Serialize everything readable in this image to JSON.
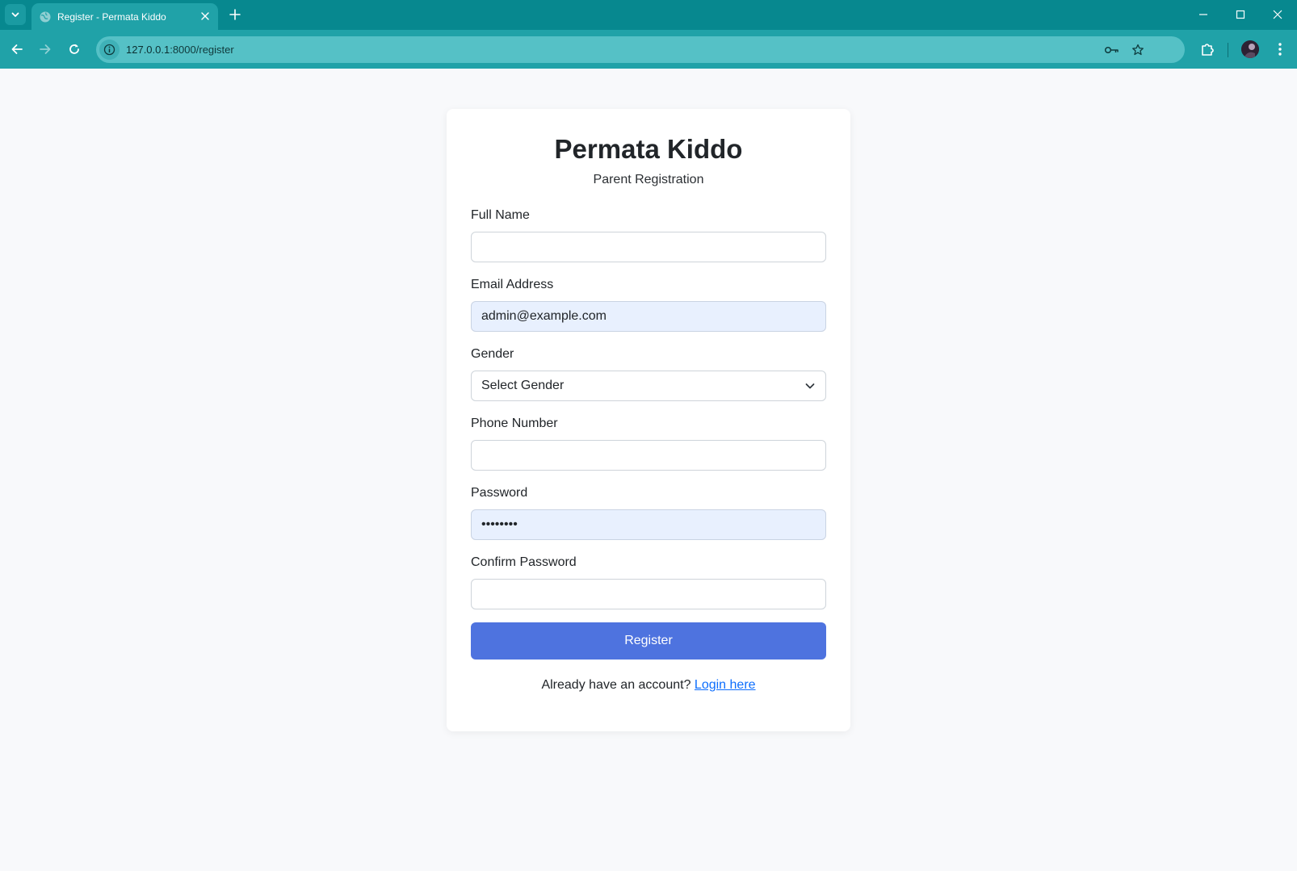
{
  "browser": {
    "tab_title": "Register - Permata Kiddo",
    "url_host": "127.0.0.1",
    "url_path": ":8000/register"
  },
  "page": {
    "brand": "Permata Kiddo",
    "subtitle": "Parent Registration",
    "fields": {
      "full_name": {
        "label": "Full Name",
        "value": ""
      },
      "email": {
        "label": "Email Address",
        "value": "admin@example.com"
      },
      "gender": {
        "label": "Gender",
        "selected": "Select Gender"
      },
      "phone": {
        "label": "Phone Number",
        "value": ""
      },
      "password": {
        "label": "Password",
        "value": "••••••••"
      },
      "confirm_password": {
        "label": "Confirm Password",
        "value": ""
      }
    },
    "register_button": "Register",
    "footer_text": "Already have an account?",
    "login_link": "Login here"
  },
  "colors": {
    "browser_frame": "#07888f",
    "toolbar": "#20a2a8",
    "primary_button": "#4e73df",
    "link": "#0d6efd",
    "autofill_bg": "#e8f0fe"
  },
  "icons": {
    "tab_menu": "chevron-down-icon",
    "favicon": "globe-icon",
    "tab_close": "close-icon",
    "new_tab": "plus-icon",
    "back": "arrow-left-icon",
    "forward": "arrow-right-icon",
    "reload": "reload-icon",
    "site_info": "info-icon",
    "password_key": "key-icon",
    "bookmark": "star-icon",
    "extensions": "puzzle-icon",
    "menu": "kebab-menu-icon",
    "select_caret": "chevron-down-icon"
  }
}
